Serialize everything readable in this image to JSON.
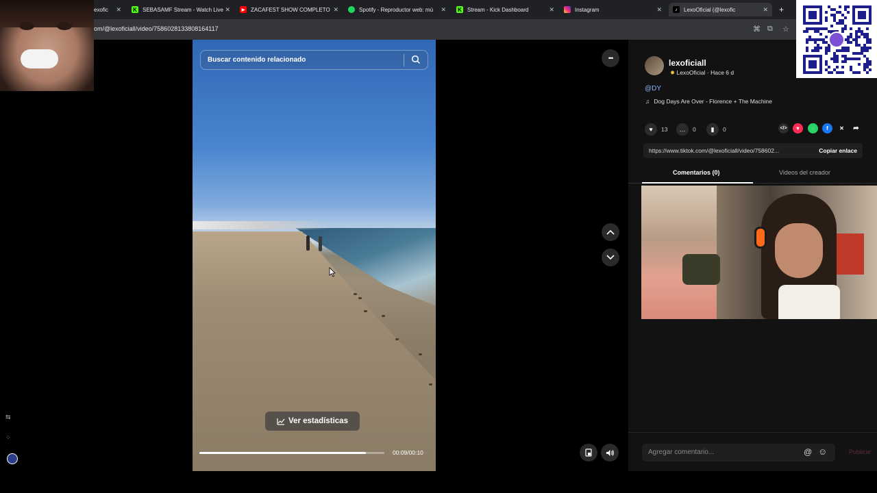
{
  "browser": {
    "tabs": [
      {
        "title": "exofic",
        "active": false
      },
      {
        "title": "SEBASAMF Stream - Watch Live",
        "active": false
      },
      {
        "title": "ZACAFEST SHOW COMPLETO",
        "active": false
      },
      {
        "title": "Spotify - Reproductor web: mú",
        "active": false
      },
      {
        "title": "Stream - Kick Dashboard",
        "active": false
      },
      {
        "title": "Instagram",
        "active": false
      },
      {
        "title": "LexoOficial (@lexofic",
        "active": true
      }
    ],
    "new_tab": "+",
    "url": "om/@lexoficiall/video/7586028133808164117"
  },
  "video": {
    "search_placeholder": "Buscar contenido relacionado",
    "stats_button": "Ver estadísticas",
    "time": "00:09/00:10",
    "progress": 0.9
  },
  "side_controls": {
    "more": "•••",
    "prev": "⌃",
    "next": "⌄"
  },
  "post": {
    "username": "lexoficiall",
    "display_line": "LexoOficial · Hace 6 d",
    "mention": "@DY",
    "music": "Dog Days Are Over - Florence + The Machine",
    "likes": "13",
    "comments": "0",
    "saves": "0",
    "link": "https://www.tiktok.com/@lexoficiall/video/758602...",
    "copy_label": "Copiar enlace",
    "tab_comments": "Comentarios (0)",
    "tab_creator": "Videos del creador",
    "comment_placeholder": "Agregar comentario...",
    "publish_label": "Publicar"
  },
  "colors": {
    "accent_red": "#fe2c55",
    "link_blue": "#8ab4f8",
    "panel_bg": "#121212"
  }
}
